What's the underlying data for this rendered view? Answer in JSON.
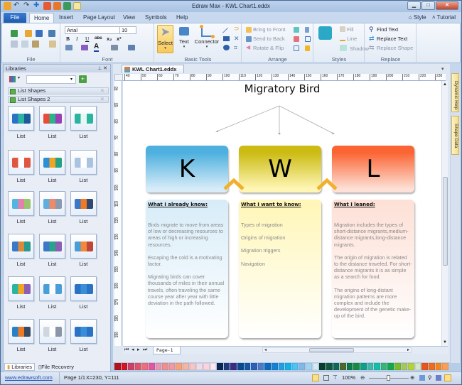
{
  "window": {
    "title": "Edraw Max - KWL Chart1.eddx",
    "controls": [
      "minimize",
      "maximize",
      "close"
    ]
  },
  "quick_access": [
    "app-icon",
    "undo-icon",
    "redo-icon",
    "connector-icon",
    "export-pdf-icon",
    "export-ppt-icon",
    "export-svg-icon",
    "document-icon"
  ],
  "ribbon_tabs": [
    "File",
    "Home",
    "Insert",
    "Page Layout",
    "View",
    "Symbols",
    "Help"
  ],
  "active_tab": "Home",
  "right_links": {
    "style": "Style",
    "tutorial": "Tutorial"
  },
  "ribbon": {
    "file_group": {
      "label": "File"
    },
    "font_group": {
      "label": "Font",
      "font_name": "Arial",
      "font_size": "10",
      "buttons": [
        "B",
        "I",
        "U",
        "abc",
        "x₂",
        "x²"
      ]
    },
    "basic_tools": {
      "label": "Basic Tools",
      "select": "Select",
      "text": "Text",
      "connector": "Connector"
    },
    "arrange": {
      "label": "Arrange",
      "bring_to_front": "Bring to Front",
      "send_to_back": "Send to Back",
      "rotate_flip": "Rotate & Flip"
    },
    "styles": {
      "label": "Styles",
      "fill": "Fill",
      "line": "Line",
      "shadow": "Shadow"
    },
    "replace": {
      "label": "Replace",
      "find_text": "Find Text",
      "replace_text": "Replace Text",
      "replace_shape": "Replace Shape"
    }
  },
  "libraries": {
    "title": "Libraries",
    "search_value": "",
    "sections": [
      "List Shapes",
      "List Shapes 2"
    ],
    "shapes": [
      "List",
      "List",
      "List",
      "List",
      "List",
      "List",
      "List",
      "List",
      "List",
      "List",
      "List",
      "List",
      "List",
      "List",
      "List",
      "List",
      "List",
      "List"
    ],
    "bottom_tabs": [
      "Libraries",
      "File Recovery"
    ]
  },
  "document": {
    "tab_title": "KWL Chart1.eddx",
    "h_ruler": [
      "40",
      "50",
      "60",
      "70",
      "80",
      "90",
      "100",
      "110",
      "120",
      "130",
      "140",
      "150",
      "160",
      "170",
      "180",
      "190",
      "200",
      "210",
      "220",
      "230"
    ],
    "v_ruler": [
      "40",
      "50",
      "60",
      "70",
      "80",
      "90",
      "100",
      "110",
      "120",
      "130",
      "140",
      "150",
      "160",
      "170",
      "180",
      "190"
    ],
    "page_tab": "Page-1",
    "chart": {
      "title": "Migratory Bird",
      "columns": [
        {
          "letter": "K",
          "heading": "What I already know:",
          "paragraphs": [
            "Birds migrate to move from areas of low or decreasing resources to areas of high or increasing resources.",
            "Escaping the cold is a motivating factor.",
            "Migrating birds can cover thousands of miles in their annual travels, often traveling the same course year after year with little deviation in the path followed."
          ],
          "header_color": "#4eb0de",
          "body_color": "#d7ecf8"
        },
        {
          "letter": "W",
          "heading": "What I want to know:",
          "paragraphs": [
            "Types of migration",
            "Origins of migration",
            "Migration triggers",
            "Navigation"
          ],
          "header_color": "#cbbb13",
          "body_color": "#fff6b6"
        },
        {
          "letter": "L",
          "heading": "What I leaned:",
          "paragraphs": [
            "Migration includes the types of short-distance migrants,medium-distance migrants,long-distance migrants.",
            "The origin of migration is related to the distance traveled. For short-distance migrants it is as simple as a search for food.",
            "The origins of long-distant migration patterns are more complex and include the development of the genetic make-up of the bird."
          ],
          "header_color": "#fb6534",
          "body_color": "#fde0d6"
        }
      ]
    }
  },
  "side_tabs": [
    "Dynamic Help",
    "Shape Data"
  ],
  "palette": [
    "#b5121b",
    "#d7141f",
    "#c94168",
    "#e05464",
    "#ea6f7a",
    "#e5579c",
    "#e896b4",
    "#ef8f8f",
    "#f19aa1",
    "#f7a27a",
    "#f5b5a1",
    "#f8c5c5",
    "#eddbe8",
    "#f9d3e0",
    "#fbe9ef",
    "#0c2755",
    "#233a7a",
    "#3b2d7f",
    "#0a4a8f",
    "#1458a3",
    "#2e5fb4",
    "#4f7ac6",
    "#0a6bc0",
    "#1b7fd0",
    "#239fe0",
    "#12b1e8",
    "#4fc3f2",
    "#82b8e5",
    "#a5d3ef",
    "#d3e9f5",
    "#0b3d2e",
    "#11573b",
    "#0f6958",
    "#4e6a2a",
    "#0a7a46",
    "#1a8a3f",
    "#0fa185",
    "#44b5a9",
    "#14c0a3",
    "#3ab578",
    "#12a84c",
    "#7bbb2a",
    "#a4c95a",
    "#b7d13e",
    "#d2e8c7",
    "#e8551f",
    "#f06c1c",
    "#f6861a",
    "#f6a05a"
  ],
  "status": {
    "link": "www.edrawsoft.com",
    "page": "Page 1/1",
    "coords": "X=230, Y=111",
    "zoom": "100%"
  }
}
